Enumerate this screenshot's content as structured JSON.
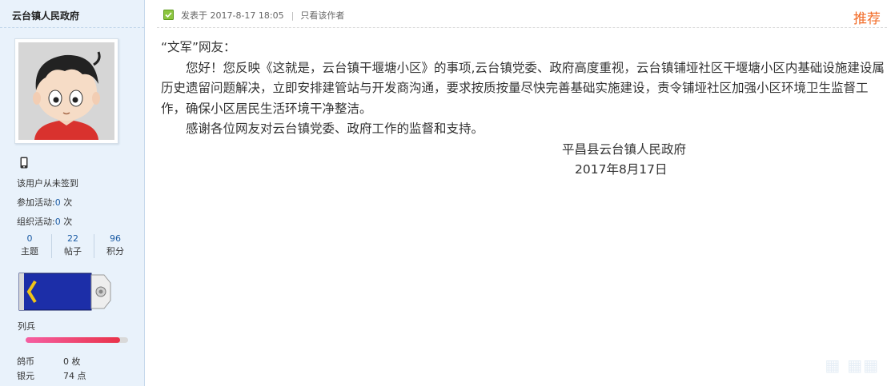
{
  "author": {
    "name": "云台镇人民政府",
    "signin_text": "该用户从未签到",
    "activities_joined_label": "参加活动:",
    "activities_joined_value": "0",
    "activities_organized_label": "组织活动:",
    "activities_organized_value": "0",
    "count_unit": " 次"
  },
  "stats": [
    {
      "value": "0",
      "label": "主题"
    },
    {
      "value": "22",
      "label": "帖子"
    },
    {
      "value": "96",
      "label": "积分"
    }
  ],
  "rank": {
    "name": "列兵",
    "progress_percent": 92
  },
  "currency": [
    {
      "label": "鸽币",
      "value": "0 枚"
    },
    {
      "label": "银元",
      "value": "74 点"
    }
  ],
  "post": {
    "posted_prefix": "发表于",
    "date": "2017-8-17 18:05",
    "only_author": "只看该作者",
    "recommend": "推荐",
    "greeting": "“文军”网友：",
    "paragraph1": "您好！您反映《这就是，云台镇干堰塘小区》的事项,云台镇党委、政府高度重视，云台镇铺垭社区干堰塘小区内基础设施建设属历史遗留问题解决，立即安排建管站与开发商沟通，要求按质按量尽快完善基础实施建设，责令铺垭社区加强小区环境卫生监督工作，确保小区居民生活环境干净整洁。",
    "paragraph2": "感谢各位网友对云台镇党委、政府工作的监督和支持。",
    "signature_org": "平昌县云台镇人民政府",
    "signature_date": "2017年8月17日"
  },
  "icons": {
    "post_status": "post-status-icon",
    "phone": "phone-icon",
    "rank_badge": "rank-badge-icon"
  },
  "colors": {
    "accent_link": "#1c5ca5",
    "recommend": "#f26c28",
    "sidebar_bg": "#e9f2fb"
  }
}
